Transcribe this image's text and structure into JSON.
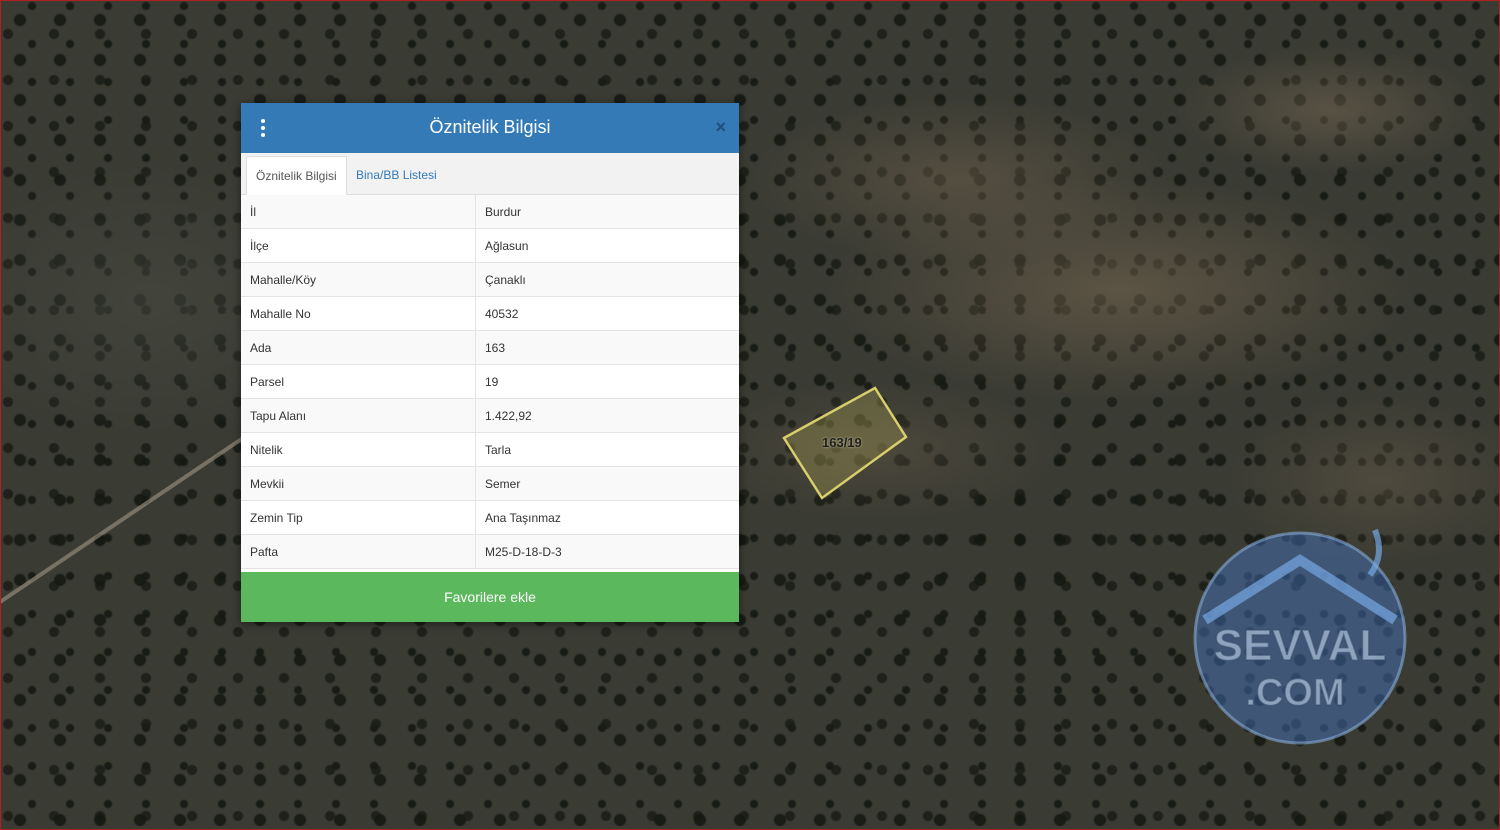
{
  "popup": {
    "title": "Öznitelik Bilgisi",
    "close_symbol": "×",
    "tabs": [
      {
        "label": "Öznitelik Bilgisi",
        "active": true
      },
      {
        "label": "Bina/BB Listesi",
        "active": false
      }
    ],
    "rows": [
      {
        "key": "İl",
        "value": "Burdur"
      },
      {
        "key": "İlçe",
        "value": "Ağlasun"
      },
      {
        "key": "Mahalle/Köy",
        "value": "Çanaklı"
      },
      {
        "key": "Mahalle No",
        "value": "40532"
      },
      {
        "key": "Ada",
        "value": "163"
      },
      {
        "key": "Parsel",
        "value": "19"
      },
      {
        "key": "Tapu Alanı",
        "value": "1.422,92"
      },
      {
        "key": "Nitelik",
        "value": "Tarla"
      },
      {
        "key": "Mevkii",
        "value": "Semer"
      },
      {
        "key": "Zemin Tip",
        "value": "Ana Taşınmaz"
      },
      {
        "key": "Pafta",
        "value": "M25-D-18-D-3"
      }
    ],
    "favorite_button": "Favorilere ekle"
  },
  "map": {
    "parcel_label": "163/19",
    "watermark_text_1": "SEVVAL",
    "watermark_text_2": ".COM"
  },
  "colors": {
    "header": "#337ab7",
    "button": "#5cb85c",
    "parcel_outline": "#d8cf6a"
  },
  "icons": {
    "menu": "vertical-dots-icon",
    "close": "close-icon"
  }
}
